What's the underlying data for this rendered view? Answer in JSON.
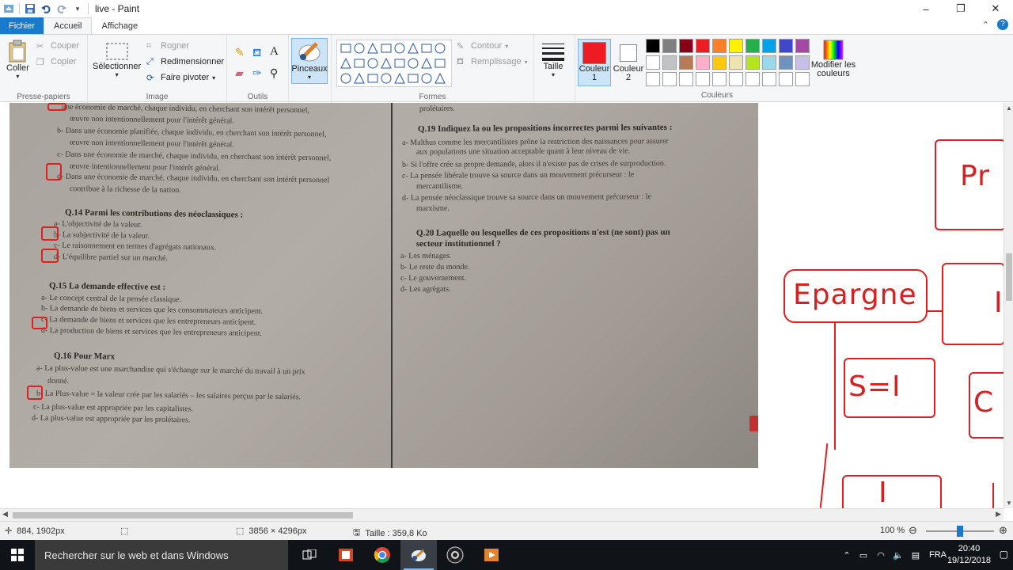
{
  "window": {
    "title": "live - Paint",
    "minimize": "–",
    "maximize": "❐",
    "close": "✕"
  },
  "tabs": {
    "file": "Fichier",
    "home": "Accueil",
    "view": "Affichage"
  },
  "ribbon": {
    "clipboard": {
      "label": "Presse-papiers",
      "paste": "Coller",
      "cut": "Couper",
      "copy": "Copier"
    },
    "image": {
      "label": "Image",
      "select": "Sélectionner",
      "crop": "Rogner",
      "resize": "Redimensionner",
      "rotate": "Faire pivoter"
    },
    "tools": {
      "label": "Outils"
    },
    "brushes": {
      "label": "Pinceaux"
    },
    "shapes": {
      "label": "Formes",
      "outline": "Contour",
      "fill": "Remplissage"
    },
    "size": {
      "label": "Taille"
    },
    "color1": {
      "label": "Couleur",
      "sub": "1",
      "value": "#ed1c24"
    },
    "color2": {
      "label": "Couleur",
      "sub": "2",
      "value": "#ffffff"
    },
    "colors": {
      "label": "Couleurs",
      "edit": "Modifier les",
      "edit2": "couleurs",
      "palette_row1": [
        "#000000",
        "#7f7f7f",
        "#880015",
        "#ed1c24",
        "#ff7f27",
        "#fff200",
        "#22b14c",
        "#00a2e8",
        "#3f48cc",
        "#a349a4"
      ],
      "palette_row2": [
        "#ffffff",
        "#c3c3c3",
        "#b97a57",
        "#ffaec9",
        "#ffc90e",
        "#efe4b0",
        "#b5e61d",
        "#99d9ea",
        "#7092be",
        "#c8bfe7"
      ],
      "palette_row3": [
        "#ffffff",
        "#ffffff",
        "#ffffff",
        "#ffffff",
        "#ffffff",
        "#ffffff",
        "#ffffff",
        "#ffffff",
        "#ffffff",
        "#ffffff"
      ]
    }
  },
  "photo": {
    "left_col": [
      "une économie de marché, chaque individu, en cherchant son intérêt personnel,",
      "œuvre non intentionnellement pour l'intérêt général.",
      "b-  Dans une économie planifiée, chaque individu, en cherchant son intérêt personnel,",
      "œuvre non intentionnellement pour l'intérêt général.",
      "c-  Dans une économie de marché, chaque individu, en cherchant son intérêt personnel,",
      "œuvre intentionnellement pour l'intérêt général.",
      "d-  Dans une économie de marché, chaque individu, en cherchant son intérêt personnel",
      "contribue à la richesse de la nation."
    ],
    "q14": "Q.14  Parmi les contributions des néoclassiques :",
    "q14_items": [
      "a-  L'objectivité de la valeur.",
      "b-  La subjectivité de la valeur.",
      "c-  Le raisonnement en termes d'agrégats nationaux.",
      "d-  L'équilibre partiel sur un marché."
    ],
    "q15": "Q.15  La demande effective est :",
    "q15_items": [
      "a-  Le concept central de la pensée classique.",
      "b-  La demande de biens et services que les consommateurs anticipent.",
      "c-  La demande de biens et services que les entrepreneurs anticipent.",
      "d-  La production de biens et services que les entrepreneurs anticipent."
    ],
    "q16": "Q.16  Pour Marx",
    "q16_items": [
      "a-  La plus-value est une marchandise qui s'échange sur le marché du travail à un prix",
      "donné.",
      "b-  La Plus-value = la valeur crée par les salariés – les salaires perçus par le salariés.",
      "c-  La plus-value est appropriée par les capitalistes.",
      "d-  La plus-value est appropriée par les prolétaires."
    ],
    "right_top": "prolétaires.",
    "q19": "Q.19  Indiquez la ou les propositions incorrectes parmi les suivantes :",
    "q19_items": [
      "a-  Malthus comme les mercantilistes prône la restriction des naissances pour assurer",
      "aux populations une situation acceptable quant à leur niveau de vie.",
      "b-  Si l'offre crée sa propre demande, alors il n'existe pas de crises de surproduction.",
      "c-  La pensée libérale trouve sa source dans un mouvement précurseur : le",
      "mercantilisme.",
      "d-  La pensée néoclassique trouve sa source dans un mouvement précurseur : le",
      "marxisme."
    ],
    "q20": "Q.20  Laquelle ou lesquelles de ces propositions n'est (ne sont) pas un",
    "q20b": "secteur institutionnel ?",
    "q20_items": [
      "a-  Les ménages.",
      "b-  Le reste du monde.",
      "c-  Le gouvernement.",
      "d-  Les agrégats."
    ]
  },
  "drawing": {
    "word1": "Pr",
    "word2": "Epargne",
    "word3": "S=I",
    "word4": "I",
    "word5": "C",
    "word6": "I"
  },
  "status": {
    "cursor": "884, 1902px",
    "dimensions": "3856 × 4296px",
    "size": "Taille : 359,8 Ko",
    "zoom": "100 %",
    "zoom_level": 0.5
  },
  "taskbar": {
    "search": "Rechercher sur le web et dans Windows",
    "lang": "FRA",
    "time": "20:40",
    "date": "19/12/2018"
  }
}
